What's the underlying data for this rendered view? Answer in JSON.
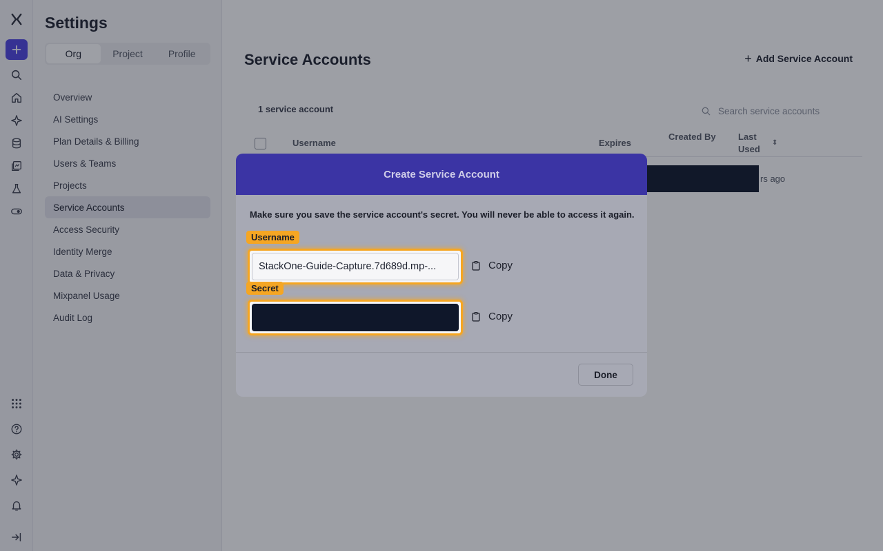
{
  "rail": {
    "icons": [
      "logo-icon",
      "plus-icon",
      "search-icon",
      "home-icon",
      "sparkle-icon",
      "database-icon",
      "boards-icon",
      "lab-icon",
      "toggle-icon",
      "apps-icon",
      "help-icon",
      "gear-icon",
      "spark-icon",
      "bell-icon",
      "collapse-icon"
    ]
  },
  "sidebar": {
    "title": "Settings",
    "tabs": [
      {
        "label": "Org",
        "active": true
      },
      {
        "label": "Project",
        "active": false
      },
      {
        "label": "Profile",
        "active": false
      }
    ],
    "items": [
      {
        "label": "Overview"
      },
      {
        "label": "AI Settings"
      },
      {
        "label": "Plan Details & Billing"
      },
      {
        "label": "Users & Teams"
      },
      {
        "label": "Projects"
      },
      {
        "label": "Service Accounts",
        "active": true
      },
      {
        "label": "Access Security"
      },
      {
        "label": "Identity Merge"
      },
      {
        "label": "Data & Privacy"
      },
      {
        "label": "Mixpanel Usage"
      },
      {
        "label": "Audit Log"
      }
    ]
  },
  "main": {
    "title": "Service Accounts",
    "add_button": "Add Service Account",
    "count_label": "1 service account",
    "search_placeholder": "Search service accounts",
    "columns": {
      "username": "Username",
      "expires": "Expires",
      "created_by": "Created By",
      "last_used": "Last Used"
    },
    "row_last_used_partial": "rs ago"
  },
  "modal": {
    "title": "Create Service Account",
    "message": "Make sure you save the service account's secret. You will never be able to access it again.",
    "username_label": "Username",
    "username_value": "StackOne-Guide-Capture.7d689d.mp-...",
    "secret_label": "Secret",
    "copy_label": "Copy",
    "done_label": "Done"
  },
  "colors": {
    "accent": "#4f44e0",
    "modal_header": "#3b34a4",
    "highlight": "#f5a623",
    "redaction": "#0f172a"
  }
}
